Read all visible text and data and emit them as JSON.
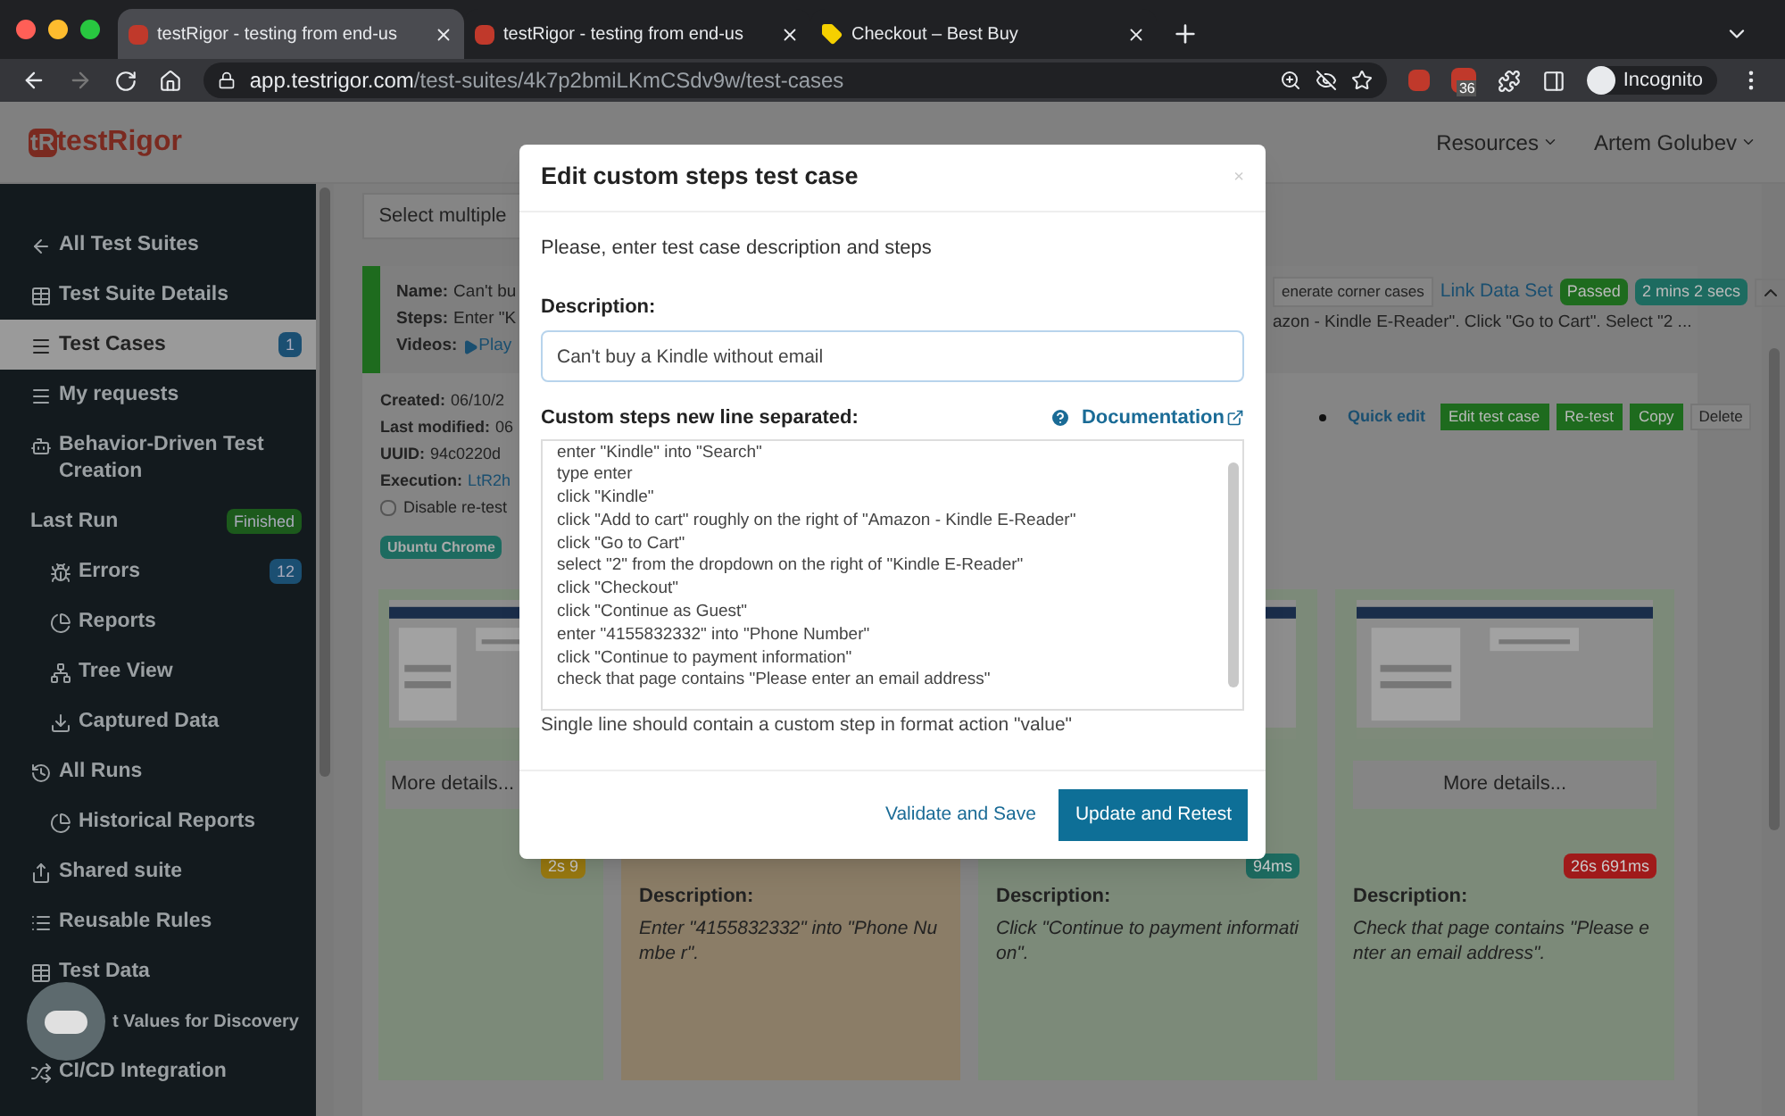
{
  "browser": {
    "tabs": [
      {
        "title": "testRigor - testing from end-us",
        "selected": true
      },
      {
        "title": "testRigor - testing from end-us",
        "selected": false
      },
      {
        "title": "Checkout – Best Buy",
        "selected": false
      }
    ],
    "url_host": "app.testrigor.com",
    "url_path": "/test-suites/4k7p2bmiLKmCSdv9w/test-cases",
    "extension_badge": "36",
    "profile": "Incognito"
  },
  "header": {
    "logo_mark": "tR",
    "logo_text": "testRigor",
    "menus": [
      "Resources",
      "Artem Golubev"
    ]
  },
  "sidebar": {
    "items": [
      {
        "label": "All Test Suites",
        "selected": false
      },
      {
        "label": "Test Suite Details",
        "selected": false
      },
      {
        "label": "Test Cases",
        "selected": true,
        "badge": {
          "text": "1",
          "color": "#1b4f72"
        }
      },
      {
        "label": "My requests",
        "selected": false
      },
      {
        "label": "Behavior-Driven Test Creation",
        "selected": false
      },
      {
        "label": "Last Run",
        "selected": false,
        "badge": {
          "text": "Finished",
          "color": "#1c5a1c"
        },
        "children": [
          {
            "label": "Errors",
            "selected": false,
            "badge": {
              "text": "12",
              "color": "#1b4f72"
            }
          },
          {
            "label": "Reports",
            "selected": false
          },
          {
            "label": "Tree View",
            "selected": false
          },
          {
            "label": "Captured Data",
            "selected": false
          }
        ]
      },
      {
        "label": "All Runs",
        "selected": false,
        "children": [
          {
            "label": "Historical Reports",
            "selected": false
          }
        ]
      },
      {
        "label": "Shared suite",
        "selected": false
      },
      {
        "label": "Reusable Rules",
        "selected": false
      },
      {
        "label": "Test Data",
        "selected": false
      },
      {
        "label": "t Values for Discovery",
        "selected": false
      },
      {
        "label": "CI/CD Integration",
        "selected": false
      }
    ]
  },
  "content": {
    "select_multiple": "Select multiple",
    "test_case": {
      "name_label": "Name:",
      "name": "Can't bu",
      "steps_label": "Steps:",
      "steps": "Enter \"K",
      "videos_label": "Videos:",
      "video_link": "Play",
      "corner_cases": "enerate corner cases",
      "link_data_set": "Link Data Set",
      "status": "Passed",
      "duration": "2 mins 2 secs",
      "steps_tail": "azon - Kindle E-Reader\". Click \"Go to Cart\". Select \"2 ...",
      "details": [
        {
          "label": "Created:",
          "value": "06/10/2",
          "kind": "text"
        },
        {
          "label": "Last modified:",
          "value": "06",
          "kind": "text"
        },
        {
          "label": "UUID:",
          "value": "94c0220d",
          "kind": "text"
        },
        {
          "label": "Execution:",
          "value": "LtR2h",
          "kind": "link"
        }
      ],
      "disable_retest": {
        "label": "Disable re-test",
        "checked": false
      },
      "tag": "Ubuntu Chrome",
      "actions": [
        {
          "label": "Quick edit",
          "kind": "link"
        },
        {
          "label": "Edit test case",
          "kind": "primary"
        },
        {
          "label": "Re-test",
          "kind": "primary"
        },
        {
          "label": "Copy",
          "kind": "primary"
        },
        {
          "label": "Delete",
          "kind": "default"
        }
      ],
      "steps_cards": [
        {
          "color": "#7c8a79",
          "more_details": "More details...",
          "badge": {
            "text": "2s 9",
            "color": "#9a7a10"
          }
        },
        {
          "color": "#8b7d67",
          "description_label": "Description:",
          "description": "Enter \"4155832332\" into \"Phone Numbe r\"."
        },
        {
          "color": "#7c8a79",
          "badge": {
            "text": "94ms",
            "color": "#1d6b60"
          },
          "description_label": "Description:",
          "description": "Click \"Continue to payment information\"."
        },
        {
          "color": "#7c8a79",
          "more_details": "More details...",
          "badge": {
            "text": "26s 691ms",
            "color": "#a01a1a"
          },
          "description_label": "Description:",
          "description": "Check that page contains \"Please enter an email address\"."
        }
      ]
    }
  },
  "modal": {
    "title": "Edit custom steps test case",
    "close": "×",
    "instructions": "Please, enter test case description and steps",
    "description_label": "Description:",
    "description_value": "Can't buy a Kindle without email",
    "steps_label": "Custom steps new line separated:",
    "documentation": "Documentation",
    "steps": [
      "enter \"Kindle\" into \"Search\"",
      "type enter",
      "click \"Kindle\"",
      "click \"Add to cart\" roughly on the right of \"Amazon - Kindle E-Reader\"",
      "click \"Go to Cart\"",
      "select \"2\" from the dropdown on the right of \"Kindle E-Reader\"",
      "click \"Checkout\"",
      "click \"Continue as Guest\"",
      "enter \"4155832332\" into \"Phone Number\"",
      "click \"Continue to payment information\"",
      "check that page contains \"Please enter an email address\""
    ],
    "hint": "Single line should contain a custom step in format action \"value\"",
    "buttons": [
      {
        "label": "Validate and Save",
        "kind": "link"
      },
      {
        "label": "Update and Retest",
        "kind": "primary"
      }
    ]
  }
}
